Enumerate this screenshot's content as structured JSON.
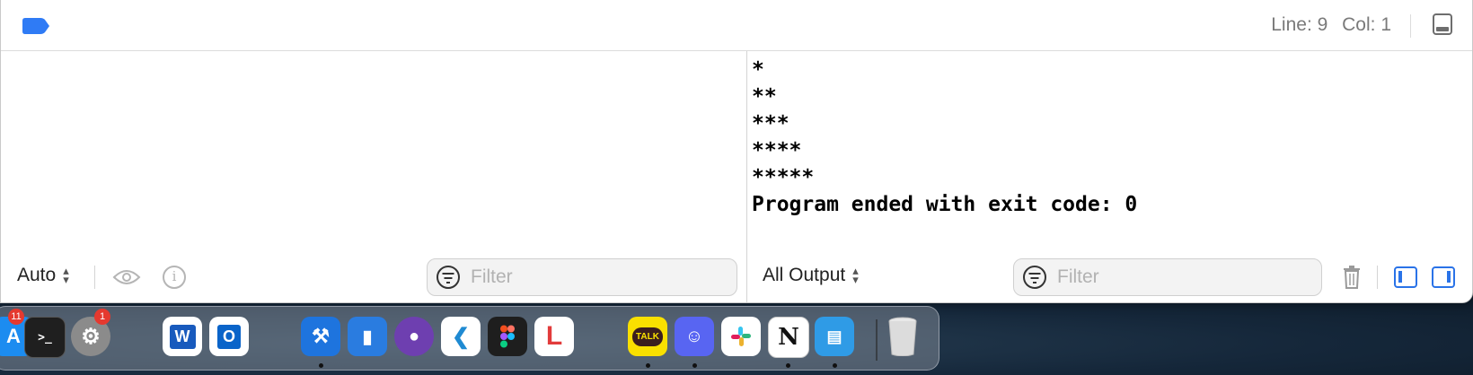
{
  "topbar": {
    "line_label": "Line: 9",
    "col_label": "Col: 1",
    "tag_color": "#2f7bf5"
  },
  "console": {
    "output": "*\n**\n***\n****\n*****\nProgram ended with exit code: 0"
  },
  "variables_bar": {
    "scope_label": "Auto",
    "filter_placeholder": "Filter"
  },
  "console_bar": {
    "output_label": "All Output",
    "filter_placeholder": "Filter"
  },
  "dock": {
    "apps": [
      {
        "name": "App Store",
        "badge": "11",
        "color": "#1c8cf0"
      },
      {
        "name": "Terminal",
        "color": "#1f1f1f"
      },
      {
        "name": "System Settings",
        "badge": "1",
        "color": "#8b8b8b"
      },
      {
        "name": "Word",
        "color": "#ffffff"
      },
      {
        "name": "Outlook",
        "color": "#ffffff"
      },
      {
        "name": "Xcode-beta",
        "color": "#1e74de"
      },
      {
        "name": "Simulator",
        "color": "#2a7ce0"
      },
      {
        "name": "GitHub Desktop",
        "color": "#6e3fb0"
      },
      {
        "name": "Visual Studio Code",
        "color": "#ffffff"
      },
      {
        "name": "Figma",
        "color": "#1e1e1e"
      },
      {
        "name": "Lasso",
        "color": "#ffffff"
      },
      {
        "name": "KakaoTalk",
        "label": "TALK",
        "color": "#f9e000"
      },
      {
        "name": "Discord",
        "color": "#5865f2"
      },
      {
        "name": "Slack",
        "color": "#ffffff"
      },
      {
        "name": "Notion",
        "label": "N",
        "color": "#ffffff"
      },
      {
        "name": "Finder-like App",
        "color": "#2f9be6"
      },
      {
        "name": "Trash",
        "color": "#d9d9d9"
      }
    ]
  }
}
